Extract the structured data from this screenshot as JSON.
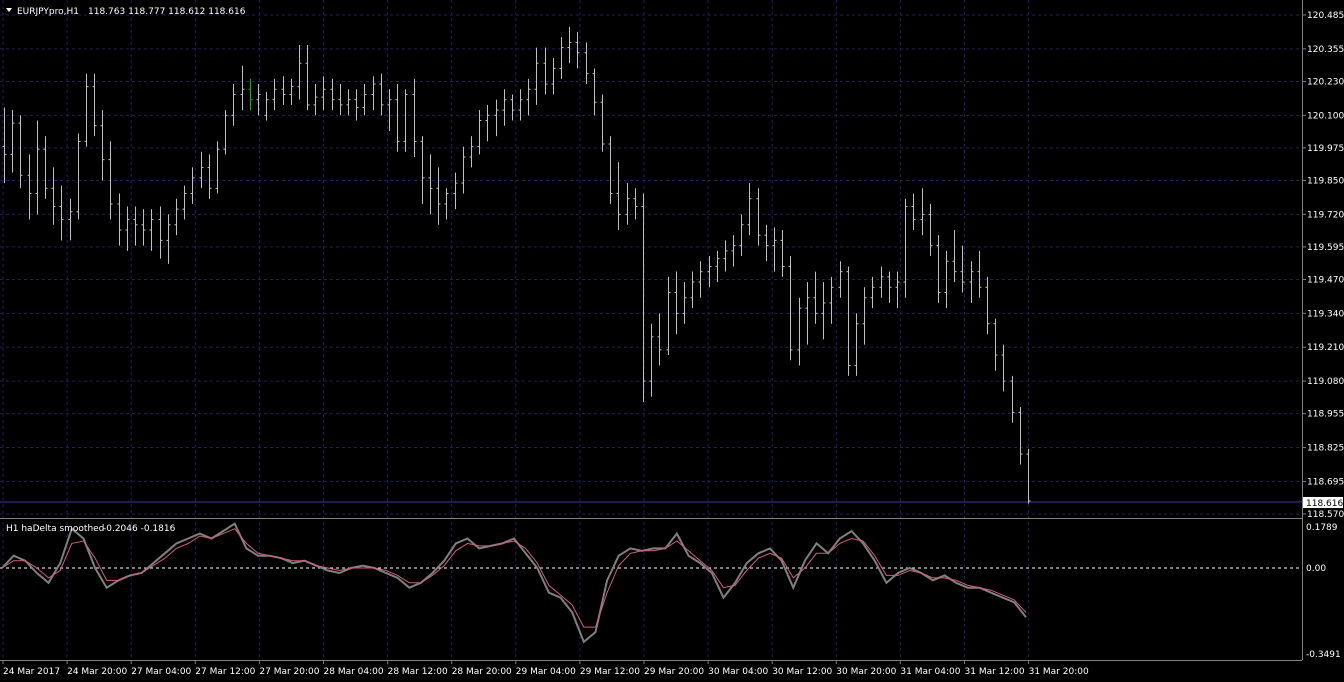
{
  "window": {
    "symbol_title": "EURJPYpro,H1",
    "ohlc": "118.763 118.777 118.612 118.616",
    "current_price": "118.616"
  },
  "indicator": {
    "title": "H1 haDelta smoothed",
    "values": "-0.2046 -0.1816",
    "scale_top": "0.1789",
    "scale_zero": "0.00",
    "scale_bottom": "-0.3491"
  },
  "colors": {
    "background": "#000000",
    "grid": "#1f1f5c",
    "bars": "#c0c0c0",
    "up_bar": "#00c000",
    "indicator_main": "#808080",
    "indicator_signal": "#d0607a",
    "price_line": "#3a3aa0"
  },
  "chart_data": {
    "type": "ohlc",
    "price_axis_labels": [
      "120.485",
      "120.355",
      "120.230",
      "120.100",
      "119.975",
      "119.850",
      "119.720",
      "119.595",
      "119.470",
      "119.340",
      "119.210",
      "119.080",
      "118.955",
      "118.825",
      "118.695",
      "118.570"
    ],
    "time_axis_labels": [
      "24 Mar 2017",
      "24 Mar 20:00",
      "27 Mar 04:00",
      "27 Mar 12:00",
      "27 Mar 20:00",
      "28 Mar 04:00",
      "28 Mar 12:00",
      "28 Mar 20:00",
      "29 Mar 04:00",
      "29 Mar 12:00",
      "29 Mar 20:00",
      "30 Mar 04:00",
      "30 Mar 12:00",
      "30 Mar 20:00",
      "31 Mar 04:00",
      "31 Mar 12:00",
      "31 Mar 20:00"
    ],
    "ylim": [
      118.57,
      120.485
    ],
    "bars": [
      [
        119.98,
        120.13,
        119.84,
        119.95
      ],
      [
        119.95,
        120.12,
        119.88,
        120.07
      ],
      [
        120.07,
        120.1,
        119.82,
        119.87
      ],
      [
        119.87,
        119.95,
        119.7,
        119.8
      ],
      [
        119.8,
        120.08,
        119.72,
        119.97
      ],
      [
        119.97,
        120.02,
        119.78,
        119.82
      ],
      [
        119.82,
        119.9,
        119.68,
        119.75
      ],
      [
        119.75,
        119.83,
        119.62,
        119.7
      ],
      [
        119.7,
        119.78,
        119.62,
        119.73
      ],
      [
        119.73,
        120.03,
        119.7,
        120.0
      ],
      [
        120.0,
        120.26,
        119.98,
        120.21
      ],
      [
        120.21,
        120.26,
        120.02,
        120.06
      ],
      [
        120.06,
        120.12,
        119.85,
        119.93
      ],
      [
        119.93,
        120.0,
        119.7,
        119.76
      ],
      [
        119.76,
        119.8,
        119.6,
        119.66
      ],
      [
        119.66,
        119.75,
        119.58,
        119.7
      ],
      [
        119.7,
        119.75,
        119.6,
        119.68
      ],
      [
        119.68,
        119.74,
        119.6,
        119.66
      ],
      [
        119.66,
        119.74,
        119.58,
        119.7
      ],
      [
        119.7,
        119.75,
        119.55,
        119.62
      ],
      [
        119.62,
        119.72,
        119.53,
        119.68
      ],
      [
        119.68,
        119.78,
        119.64,
        119.74
      ],
      [
        119.74,
        119.83,
        119.7,
        119.8
      ],
      [
        119.8,
        119.9,
        119.76,
        119.86
      ],
      [
        119.86,
        119.96,
        119.82,
        119.9
      ],
      [
        119.9,
        119.95,
        119.78,
        119.82
      ],
      [
        119.82,
        120.0,
        119.8,
        119.97
      ],
      [
        119.97,
        120.12,
        119.95,
        120.1
      ],
      [
        120.1,
        120.22,
        120.06,
        120.18
      ],
      [
        120.18,
        120.29,
        120.12,
        120.2
      ],
      [
        120.2,
        120.24,
        120.12,
        120.16
      ],
      [
        120.16,
        120.22,
        120.1,
        120.18
      ],
      [
        120.1,
        120.19,
        120.08,
        120.16
      ],
      [
        120.16,
        120.24,
        120.12,
        120.2
      ],
      [
        120.2,
        120.25,
        120.14,
        120.18
      ],
      [
        120.18,
        120.24,
        120.14,
        120.21
      ],
      [
        120.21,
        120.37,
        120.16,
        120.3
      ],
      [
        120.3,
        120.37,
        120.12,
        120.14
      ],
      [
        120.14,
        120.22,
        120.1,
        120.17
      ],
      [
        120.17,
        120.25,
        120.12,
        120.2
      ],
      [
        120.2,
        120.24,
        120.12,
        120.16
      ],
      [
        120.16,
        120.22,
        120.1,
        120.14
      ],
      [
        120.14,
        120.2,
        120.1,
        120.16
      ],
      [
        120.16,
        120.2,
        120.08,
        120.13
      ],
      [
        120.13,
        120.22,
        120.1,
        120.18
      ],
      [
        120.18,
        120.25,
        120.12,
        120.22
      ],
      [
        120.22,
        120.26,
        120.1,
        120.14
      ],
      [
        120.14,
        120.2,
        120.04,
        120.16
      ],
      [
        120.16,
        120.22,
        119.96,
        120.0
      ],
      [
        120.0,
        120.2,
        119.96,
        120.18
      ],
      [
        120.18,
        120.24,
        119.94,
        120.0
      ],
      [
        120.0,
        120.02,
        119.76,
        119.86
      ],
      [
        119.86,
        119.95,
        119.72,
        119.82
      ],
      [
        119.82,
        119.9,
        119.68,
        119.76
      ],
      [
        119.76,
        119.82,
        119.7,
        119.8
      ],
      [
        119.8,
        119.88,
        119.74,
        119.84
      ],
      [
        119.84,
        119.98,
        119.8,
        119.94
      ],
      [
        119.94,
        120.02,
        119.9,
        119.98
      ],
      [
        119.98,
        120.12,
        119.95,
        120.08
      ],
      [
        120.08,
        120.14,
        120.0,
        120.1
      ],
      [
        120.1,
        120.16,
        120.02,
        120.12
      ],
      [
        120.12,
        120.2,
        120.06,
        120.16
      ],
      [
        120.16,
        120.18,
        120.08,
        120.12
      ],
      [
        120.12,
        120.2,
        120.08,
        120.16
      ],
      [
        120.16,
        120.24,
        120.1,
        120.2
      ],
      [
        120.2,
        120.36,
        120.14,
        120.3
      ],
      [
        120.3,
        120.36,
        120.18,
        120.22
      ],
      [
        120.22,
        120.32,
        120.18,
        120.28
      ],
      [
        120.28,
        120.4,
        120.24,
        120.36
      ],
      [
        120.36,
        120.44,
        120.3,
        120.38
      ],
      [
        120.38,
        120.42,
        120.28,
        120.34
      ],
      [
        120.34,
        120.38,
        120.22,
        120.26
      ],
      [
        120.26,
        120.28,
        120.1,
        120.15
      ],
      [
        120.15,
        120.18,
        119.96,
        119.99
      ],
      [
        119.99,
        120.02,
        119.76,
        119.8
      ],
      [
        119.8,
        119.92,
        119.66,
        119.72
      ],
      [
        119.72,
        119.84,
        119.68,
        119.78
      ],
      [
        119.78,
        119.82,
        119.7,
        119.75
      ],
      [
        119.75,
        119.8,
        119.0,
        119.08
      ],
      [
        119.08,
        119.3,
        119.02,
        119.25
      ],
      [
        119.25,
        119.34,
        119.14,
        119.2
      ],
      [
        119.2,
        119.48,
        119.18,
        119.42
      ],
      [
        119.42,
        119.5,
        119.26,
        119.34
      ],
      [
        119.34,
        119.46,
        119.3,
        119.4
      ],
      [
        119.4,
        119.5,
        119.36,
        119.46
      ],
      [
        119.46,
        119.54,
        119.4,
        119.5
      ],
      [
        119.5,
        119.56,
        119.44,
        119.52
      ],
      [
        119.52,
        119.58,
        119.46,
        119.55
      ],
      [
        119.55,
        119.62,
        119.5,
        119.58
      ],
      [
        119.58,
        119.64,
        119.52,
        119.6
      ],
      [
        119.6,
        119.72,
        119.56,
        119.68
      ],
      [
        119.68,
        119.84,
        119.64,
        119.78
      ],
      [
        119.78,
        119.82,
        119.6,
        119.64
      ],
      [
        119.64,
        119.68,
        119.54,
        119.6
      ],
      [
        119.6,
        119.67,
        119.5,
        119.62
      ],
      [
        119.62,
        119.66,
        119.48,
        119.52
      ],
      [
        119.52,
        119.56,
        119.16,
        119.2
      ],
      [
        119.2,
        119.4,
        119.14,
        119.36
      ],
      [
        119.36,
        119.46,
        119.22,
        119.4
      ],
      [
        119.4,
        119.5,
        119.3,
        119.34
      ],
      [
        119.34,
        119.46,
        119.24,
        119.38
      ],
      [
        119.38,
        119.48,
        119.3,
        119.44
      ],
      [
        119.44,
        119.54,
        119.4,
        119.5
      ],
      [
        119.5,
        119.52,
        119.1,
        119.14
      ],
      [
        119.14,
        119.34,
        119.1,
        119.3
      ],
      [
        119.3,
        119.44,
        119.22,
        119.4
      ],
      [
        119.4,
        119.48,
        119.36,
        119.44
      ],
      [
        119.44,
        119.52,
        119.4,
        119.48
      ],
      [
        119.48,
        119.5,
        119.38,
        119.44
      ],
      [
        119.44,
        119.5,
        119.36,
        119.46
      ],
      [
        119.46,
        119.78,
        119.4,
        119.75
      ],
      [
        119.75,
        119.8,
        119.66,
        119.7
      ],
      [
        119.7,
        119.82,
        119.64,
        119.72
      ],
      [
        119.72,
        119.76,
        119.56,
        119.6
      ],
      [
        119.6,
        119.64,
        119.38,
        119.42
      ],
      [
        119.42,
        119.58,
        119.36,
        119.54
      ],
      [
        119.54,
        119.66,
        119.46,
        119.5
      ],
      [
        119.5,
        119.6,
        119.42,
        119.46
      ],
      [
        119.46,
        119.54,
        119.38,
        119.5
      ],
      [
        119.5,
        119.58,
        119.4,
        119.44
      ],
      [
        119.44,
        119.48,
        119.26,
        119.3
      ],
      [
        119.3,
        119.32,
        119.12,
        119.18
      ],
      [
        119.18,
        119.22,
        119.04,
        119.08
      ],
      [
        119.08,
        119.1,
        118.92,
        118.96
      ],
      [
        118.96,
        118.98,
        118.76,
        118.8
      ],
      [
        118.8,
        118.82,
        118.61,
        118.62
      ]
    ],
    "series": [
      {
        "values": [
          0.0,
          0.05,
          0.03,
          -0.02,
          -0.06,
          0.02,
          0.16,
          0.12,
          0.0,
          -0.08,
          -0.05,
          -0.03,
          -0.02,
          0.02,
          0.06,
          0.1,
          0.12,
          0.14,
          0.12,
          0.15,
          0.18,
          0.08,
          0.05,
          0.05,
          0.04,
          0.02,
          0.03,
          0.01,
          -0.01,
          -0.02,
          0.0,
          0.01,
          0.0,
          -0.02,
          -0.04,
          -0.08,
          -0.06,
          -0.02,
          0.03,
          0.1,
          0.12,
          0.08,
          0.09,
          0.1,
          0.12,
          0.06,
          0.0,
          -0.1,
          -0.12,
          -0.18,
          -0.3,
          -0.26,
          -0.05,
          0.05,
          0.08,
          0.07,
          0.08,
          0.08,
          0.14,
          0.05,
          0.02,
          -0.02,
          -0.12,
          -0.06,
          0.02,
          0.06,
          0.08,
          0.03,
          -0.08,
          0.03,
          0.1,
          0.06,
          0.12,
          0.15,
          0.1,
          0.03,
          -0.06,
          -0.02,
          0.0,
          -0.02,
          -0.05,
          -0.03,
          -0.06,
          -0.08,
          -0.08,
          -0.1,
          -0.12,
          -0.14,
          -0.2
        ]
      },
      {
        "values": [
          0.0,
          0.03,
          0.03,
          0.0,
          -0.04,
          -0.01,
          0.1,
          0.11,
          0.04,
          -0.05,
          -0.05,
          -0.03,
          -0.02,
          0.01,
          0.04,
          0.08,
          0.1,
          0.13,
          0.12,
          0.14,
          0.16,
          0.1,
          0.06,
          0.05,
          0.04,
          0.03,
          0.03,
          0.01,
          0.0,
          -0.01,
          0.0,
          0.0,
          0.0,
          -0.01,
          -0.03,
          -0.06,
          -0.06,
          -0.03,
          0.01,
          0.07,
          0.1,
          0.09,
          0.09,
          0.1,
          0.11,
          0.08,
          0.02,
          -0.07,
          -0.11,
          -0.15,
          -0.24,
          -0.24,
          -0.1,
          0.01,
          0.06,
          0.07,
          0.07,
          0.08,
          0.11,
          0.07,
          0.03,
          -0.01,
          -0.08,
          -0.07,
          -0.01,
          0.04,
          0.06,
          0.04,
          -0.04,
          0.0,
          0.06,
          0.06,
          0.1,
          0.12,
          0.11,
          0.05,
          -0.03,
          -0.03,
          -0.01,
          -0.02,
          -0.04,
          -0.04,
          -0.05,
          -0.07,
          -0.08,
          -0.09,
          -0.11,
          -0.13,
          -0.18
        ]
      }
    ],
    "indicator_ylim": [
      -0.3491,
      0.1789
    ]
  }
}
